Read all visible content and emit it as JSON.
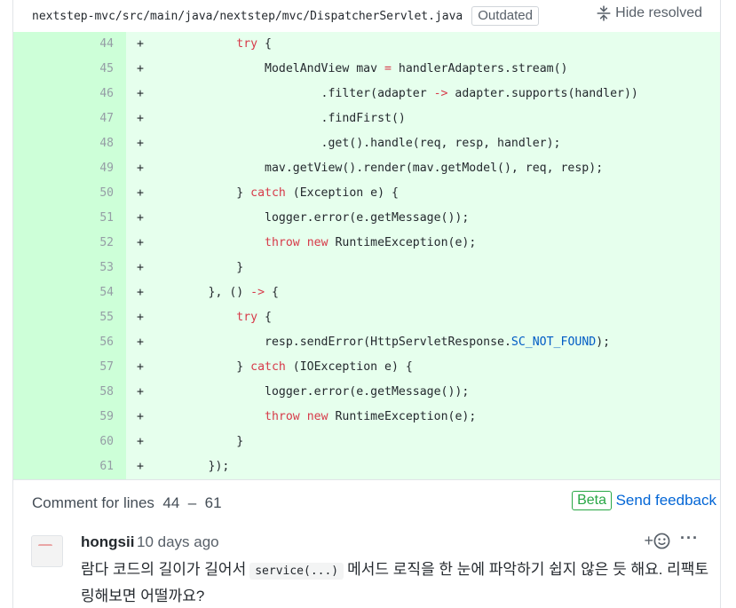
{
  "file": {
    "path": "nextstep-mvc/src/main/java/nextstep/mvc/DispatcherServlet.java",
    "badge": "Outdated",
    "hide_resolved": "Hide resolved"
  },
  "lines": [
    {
      "num": "44",
      "marker": "+",
      "segments": [
        {
          "t": "            "
        },
        {
          "t": "try",
          "k": "kw"
        },
        {
          "t": " {"
        }
      ]
    },
    {
      "num": "45",
      "marker": "+",
      "segments": [
        {
          "t": "                ModelAndView mav "
        },
        {
          "t": "=",
          "k": "kw"
        },
        {
          "t": " handlerAdapters.stream()"
        }
      ]
    },
    {
      "num": "46",
      "marker": "+",
      "segments": [
        {
          "t": "                        .filter(adapter "
        },
        {
          "t": "->",
          "k": "kw"
        },
        {
          "t": " adapter.supports(handler))"
        }
      ]
    },
    {
      "num": "47",
      "marker": "+",
      "segments": [
        {
          "t": "                        .findFirst()"
        }
      ]
    },
    {
      "num": "48",
      "marker": "+",
      "segments": [
        {
          "t": "                        .get().handle(req, resp, handler);"
        }
      ]
    },
    {
      "num": "49",
      "marker": "+",
      "segments": [
        {
          "t": "                mav.getView().render(mav.getModel(), req, resp);"
        }
      ]
    },
    {
      "num": "50",
      "marker": "+",
      "segments": [
        {
          "t": "            } "
        },
        {
          "t": "catch",
          "k": "kw"
        },
        {
          "t": " (Exception e) {"
        }
      ]
    },
    {
      "num": "51",
      "marker": "+",
      "segments": [
        {
          "t": "                logger.error(e.getMessage());"
        }
      ]
    },
    {
      "num": "52",
      "marker": "+",
      "segments": [
        {
          "t": "                "
        },
        {
          "t": "throw",
          "k": "kw"
        },
        {
          "t": " "
        },
        {
          "t": "new",
          "k": "kw"
        },
        {
          "t": " RuntimeException(e);"
        }
      ]
    },
    {
      "num": "53",
      "marker": "+",
      "segments": [
        {
          "t": "            }"
        }
      ]
    },
    {
      "num": "54",
      "marker": "+",
      "segments": [
        {
          "t": "        }, () "
        },
        {
          "t": "->",
          "k": "kw"
        },
        {
          "t": " {"
        }
      ]
    },
    {
      "num": "55",
      "marker": "+",
      "segments": [
        {
          "t": "            "
        },
        {
          "t": "try",
          "k": "kw"
        },
        {
          "t": " {"
        }
      ]
    },
    {
      "num": "56",
      "marker": "+",
      "segments": [
        {
          "t": "                resp.sendError(HttpServletResponse."
        },
        {
          "t": "SC_NOT_FOUND",
          "k": "const"
        },
        {
          "t": ");"
        }
      ]
    },
    {
      "num": "57",
      "marker": "+",
      "segments": [
        {
          "t": "            } "
        },
        {
          "t": "catch",
          "k": "kw"
        },
        {
          "t": " (IOException e) {"
        }
      ]
    },
    {
      "num": "58",
      "marker": "+",
      "segments": [
        {
          "t": "                logger.error(e.getMessage());"
        }
      ]
    },
    {
      "num": "59",
      "marker": "+",
      "segments": [
        {
          "t": "                "
        },
        {
          "t": "throw",
          "k": "kw"
        },
        {
          "t": " "
        },
        {
          "t": "new",
          "k": "kw"
        },
        {
          "t": " RuntimeException(e);"
        }
      ]
    },
    {
      "num": "60",
      "marker": "+",
      "segments": [
        {
          "t": "            }"
        }
      ]
    },
    {
      "num": "61",
      "marker": "+",
      "segments": [
        {
          "t": "        });"
        }
      ]
    }
  ],
  "comment_bar": {
    "label": "Comment for lines  44  –  61",
    "beta": "Beta",
    "send_feedback": "Send feedback"
  },
  "comment": {
    "author": "hongsii",
    "time": "10 days ago",
    "body_before": "람다 코드의 길이가 길어서",
    "body_code": "service(...)",
    "body_after": "메서드 로직을 한 눈에 파악하기 쉽지 않은 듯 해요. 리팩토링해보면 어떨까요?",
    "reaction_icon": "smiley-icon",
    "more_label": "···"
  },
  "colors": {
    "added_line_bg": "#e6ffed",
    "added_num_bg": "#cdffd8",
    "keyword": "#d73a49",
    "constant": "#005cc5",
    "link": "#0366d6",
    "beta": "#28a745"
  }
}
